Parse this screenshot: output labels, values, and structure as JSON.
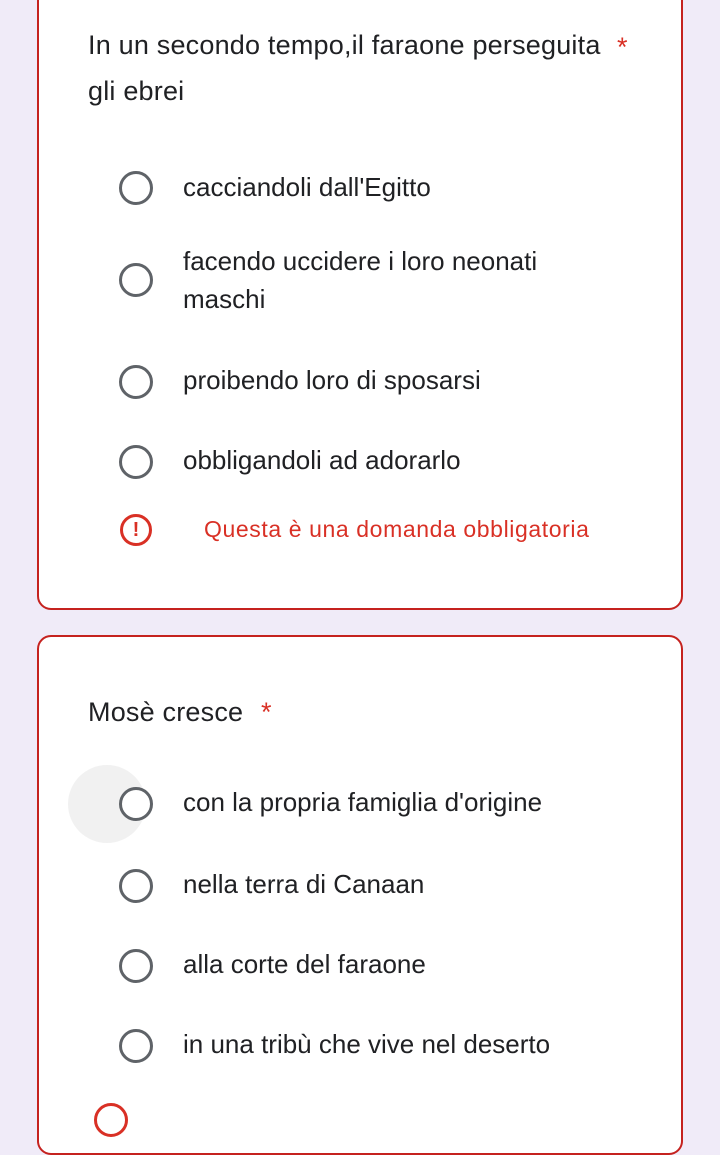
{
  "questions": [
    {
      "title": "In un secondo tempo,il faraone perseguita gli ebrei",
      "required_mark": "*",
      "options": [
        "cacciandoli dall'Egitto",
        "facendo uccidere i loro neonati maschi",
        "proibendo loro di sposarsi",
        "obbligandoli ad adorarlo"
      ],
      "error": {
        "icon": "exclamation-icon",
        "text": "Questa è una domanda obbligatoria"
      }
    },
    {
      "title": "Mosè cresce",
      "required_mark": "*",
      "options": [
        "con la propria famiglia d'origine",
        "nella terra di Canaan",
        "alla corte del faraone",
        "in una tribù che vive nel deserto"
      ]
    }
  ],
  "colors": {
    "background": "#f0ebf8",
    "error": "#d93025",
    "text": "#202124",
    "radio_border": "#5f6368"
  }
}
